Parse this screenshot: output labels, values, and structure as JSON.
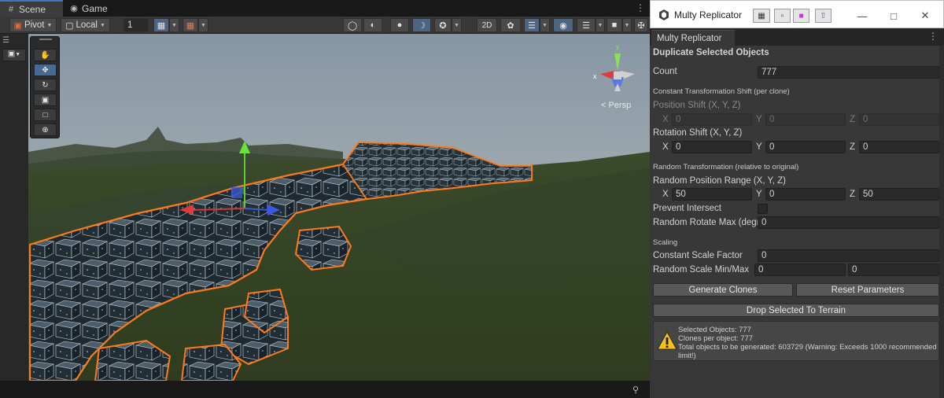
{
  "scene_window": {
    "tabs": [
      {
        "label": "Scene",
        "icon": "grid-icon",
        "active": true
      },
      {
        "label": "Game",
        "icon": "gamepad-icon",
        "active": false
      }
    ],
    "toolbar": {
      "pivot_label": "Pivot",
      "local_label": "Local",
      "grid_value": "1"
    },
    "tools": [
      "hand-tool",
      "move-tool",
      "rotate-tool",
      "scale-tool",
      "rect-tool",
      "transform-tool"
    ],
    "active_tool": "move-tool",
    "gizmo": {
      "axis_x": "x",
      "axis_y": "y",
      "view_label": "< Persp"
    },
    "colors": {
      "selection_outline": "#ff7a1a",
      "sky": "#9aa7b1",
      "terrain": "#2c3a1f",
      "accent": "#3a79bb"
    }
  },
  "replicator": {
    "window_title": "Multy Replicator",
    "tab_label": "Multy Replicator",
    "section_duplicate": "Duplicate Selected Objects",
    "count_label": "Count",
    "count_value": "777",
    "section_constant": "Constant Transformation Shift (per clone)",
    "position_shift_label": "Position Shift (X, Y, Z)",
    "position_shift": {
      "x": "0",
      "y": "0",
      "z": "0"
    },
    "rotation_shift_label": "Rotation Shift (X, Y, Z)",
    "rotation_shift": {
      "x": "0",
      "y": "0",
      "z": "0"
    },
    "section_random": "Random Transformation (relative to original)",
    "random_position_label": "Random Position Range (X, Y, Z)",
    "random_position": {
      "x": "50",
      "y": "0",
      "z": "50"
    },
    "prevent_intersect_label": "Prevent Intersect",
    "prevent_intersect_checked": false,
    "random_rotate_label": "Random Rotate Max (degr",
    "random_rotate_value": "0",
    "section_scaling": "Scaling",
    "constant_scale_label": "Constant Scale Factor",
    "constant_scale_value": "0",
    "random_scale_label": "Random Scale Min/Max",
    "random_scale_min": "0",
    "random_scale_max": "0",
    "generate_button": "Generate Clones",
    "reset_button": "Reset Parameters",
    "drop_button": "Drop Selected To Terrain",
    "axis_labels": {
      "x": "X",
      "y": "Y",
      "z": "Z"
    },
    "warning": {
      "line1": "Selected Objects: 777",
      "line2": "Clones per object: 777",
      "line3": "Total objects to be generated: 603729 (Warning: Exceeds 1000 recommended limit!)"
    },
    "colors": {
      "warning_icon": "#f2c21b",
      "button": "#585858",
      "panel": "#383838"
    }
  }
}
